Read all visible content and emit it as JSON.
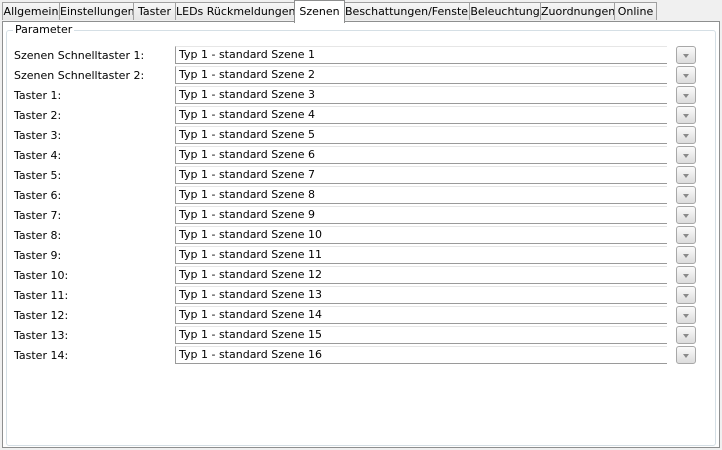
{
  "tabs": [
    {
      "label": "Allgemein",
      "active": false
    },
    {
      "label": "Einstellungen",
      "active": false
    },
    {
      "label": "Taster",
      "active": false
    },
    {
      "label": "LEDs Rückmeldungen",
      "active": false
    },
    {
      "label": "Szenen",
      "active": true
    },
    {
      "label": "Beschattungen/Fenster",
      "active": false
    },
    {
      "label": "Beleuchtung",
      "active": false
    },
    {
      "label": "Zuordnungen",
      "active": false
    },
    {
      "label": "Online",
      "active": false
    }
  ],
  "group": {
    "caption": "Parameter"
  },
  "rows": [
    {
      "label": "Szenen Schnelltaster 1:",
      "value": "Typ 1 - standard Szene 1"
    },
    {
      "label": "Szenen Schnelltaster 2:",
      "value": "Typ 1 - standard Szene 2"
    },
    {
      "label": "Taster 1:",
      "value": "Typ 1 - standard Szene 3"
    },
    {
      "label": "Taster 2:",
      "value": "Typ 1 - standard Szene 4"
    },
    {
      "label": "Taster 3:",
      "value": "Typ 1 - standard Szene 5"
    },
    {
      "label": "Taster 4:",
      "value": "Typ 1 - standard Szene 6"
    },
    {
      "label": "Taster 5:",
      "value": "Typ 1 - standard Szene 7"
    },
    {
      "label": "Taster 6:",
      "value": "Typ 1 - standard Szene 8"
    },
    {
      "label": "Taster 7:",
      "value": "Typ 1 - standard Szene 9"
    },
    {
      "label": "Taster 8:",
      "value": "Typ 1 - standard Szene 10"
    },
    {
      "label": "Taster 9:",
      "value": "Typ 1 - standard Szene 11"
    },
    {
      "label": "Taster 10:",
      "value": "Typ 1 - standard Szene 12"
    },
    {
      "label": "Taster 11:",
      "value": "Typ 1 - standard Szene 13"
    },
    {
      "label": "Taster 12:",
      "value": "Typ 1 - standard Szene 14"
    },
    {
      "label": "Taster 13:",
      "value": "Typ 1 - standard Szene 15"
    },
    {
      "label": "Taster 14:",
      "value": "Typ 1 - standard Szene 16"
    }
  ],
  "icons": {
    "dropdown": "chevron-down-icon"
  },
  "colors": {
    "panel_background": "#ffffff",
    "window_background": "#f0f0f0",
    "border": "#8e8f8f"
  }
}
